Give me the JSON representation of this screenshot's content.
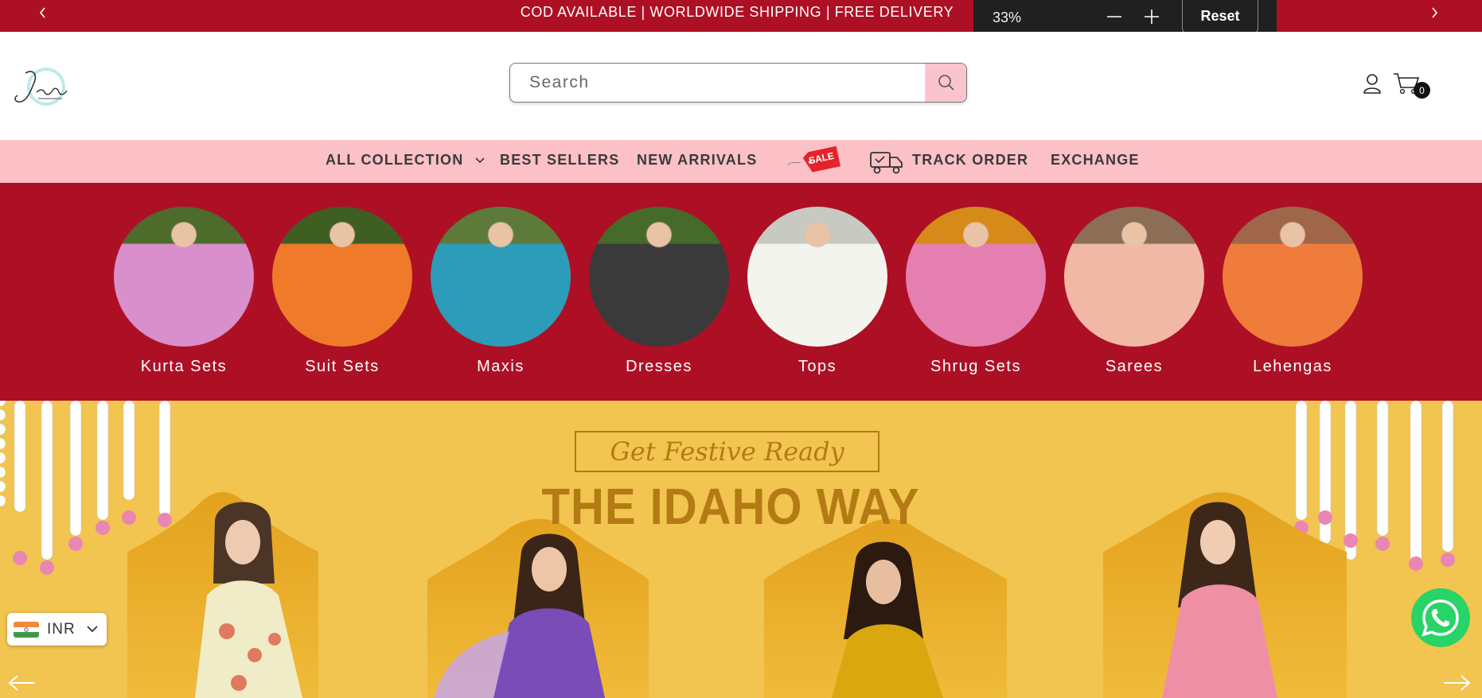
{
  "announcement": {
    "message": "COD AVAILABLE | WORLDWIDE SHIPPING | FREE DELIVERY",
    "prev_icon": "chevron-left-icon",
    "next_icon": "chevron-right-icon"
  },
  "zoom_popup": {
    "level": "33%",
    "reset_label": "Reset"
  },
  "header": {
    "search_placeholder": "Search",
    "cart_count": "0"
  },
  "nav": {
    "items": [
      {
        "label": "ALL COLLECTION",
        "has_dropdown": true
      },
      {
        "label": "BEST SELLERS"
      },
      {
        "label": "NEW ARRIVALS"
      },
      {
        "label": "TRACK ORDER"
      },
      {
        "label": "EXCHANGE"
      }
    ],
    "sale_badge": "SALE"
  },
  "categories": [
    {
      "label": "Kurta Sets",
      "palette": [
        "#4d6b2a",
        "#d98fcb",
        "#9bbd4a"
      ]
    },
    {
      "label": "Suit Sets",
      "palette": [
        "#3f5e22",
        "#ef7a2a",
        "#6b4fb0"
      ]
    },
    {
      "label": "Maxis",
      "palette": [
        "#5d7a3a",
        "#2c9cb8",
        "#b79a58"
      ]
    },
    {
      "label": "Dresses",
      "palette": [
        "#466a2a",
        "#3a3a3a",
        "#6a6a6a"
      ]
    },
    {
      "label": "Tops",
      "palette": [
        "#c7c9c2",
        "#f4f4ee",
        "#a9b04a"
      ]
    },
    {
      "label": "Shrug Sets",
      "palette": [
        "#d58a1a",
        "#e47fb0",
        "#c94a3a"
      ]
    },
    {
      "label": "Sarees",
      "palette": [
        "#8c6d55",
        "#f2b8a6",
        "#b33a2a"
      ]
    },
    {
      "label": "Lehengas",
      "palette": [
        "#a0664a",
        "#ef7c3a",
        "#d8a54a"
      ]
    }
  ],
  "hero": {
    "tagline": "Get Festive Ready",
    "headline": "THE IDAHO WAY",
    "background": "#f2c450",
    "accent": "#b47a14"
  },
  "currency": {
    "code": "INR"
  },
  "colors": {
    "brand_red": "#ad1024",
    "nav_pink": "#fcc0c7",
    "whatsapp_green": "#28d367"
  }
}
